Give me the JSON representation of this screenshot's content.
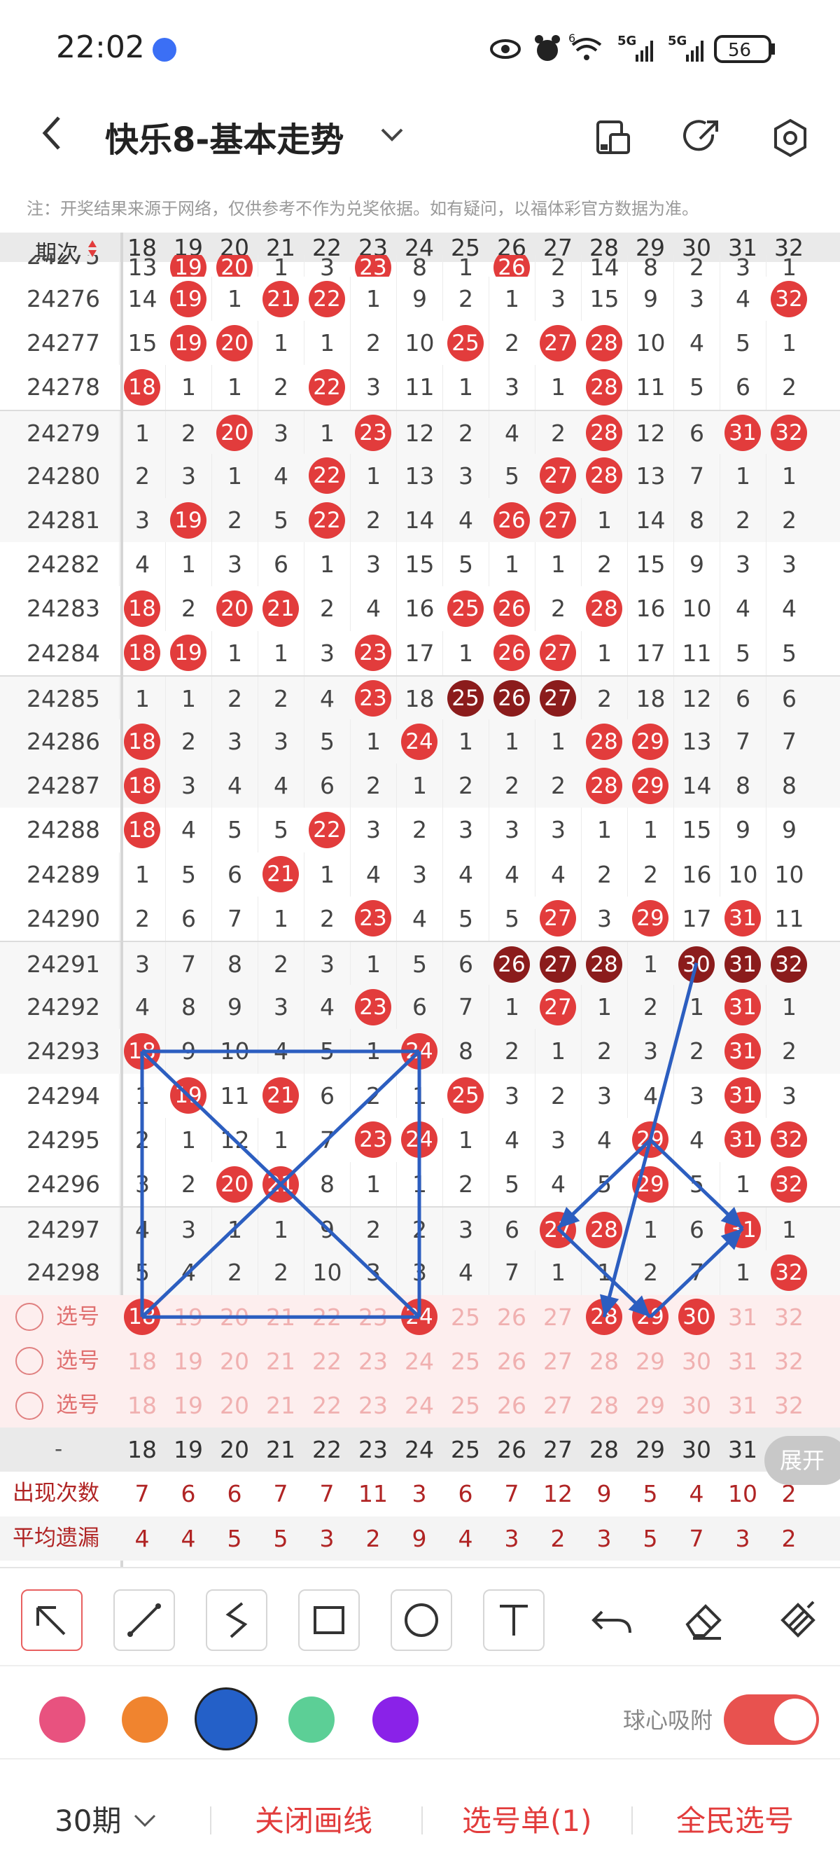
{
  "status_bar": {
    "time": "22:02",
    "battery": "56",
    "net1": "5G",
    "net2": "5G",
    "wifi_badge": "6"
  },
  "header": {
    "title": "快乐8-基本走势",
    "icons": [
      "back-arrow-icon",
      "dropdown-chevron-icon",
      "layout-icon",
      "share-icon",
      "settings-icon"
    ]
  },
  "note": "注：开奖结果来源于网络，仅供参考不作为兑奖依据。如有疑问，以福体彩官方数据为准。",
  "table": {
    "header_label": "期次",
    "sort_icon": "sort-icon",
    "columns": [
      "18",
      "19",
      "20",
      "21",
      "22",
      "23",
      "24",
      "25",
      "26",
      "27",
      "28",
      "29",
      "30",
      "31",
      "32"
    ],
    "partial_row_period": "24275",
    "partial_row_cells": [
      "13",
      "19",
      "20",
      "1",
      "3",
      "23",
      "8",
      "1",
      "26",
      "2",
      "14",
      "8",
      "2",
      "3",
      "1"
    ],
    "rows": [
      {
        "period": "24276",
        "cells": [
          "14",
          "19",
          "1",
          "21",
          "22",
          "1",
          "9",
          "2",
          "1",
          "3",
          "15",
          "9",
          "3",
          "4",
          "32"
        ]
      },
      {
        "period": "24277",
        "cells": [
          "15",
          "19",
          "20",
          "1",
          "1",
          "2",
          "10",
          "25",
          "2",
          "27",
          "28",
          "10",
          "4",
          "5",
          "1"
        ]
      },
      {
        "period": "24278",
        "cells": [
          "18",
          "1",
          "1",
          "2",
          "22",
          "3",
          "11",
          "1",
          "3",
          "1",
          "28",
          "11",
          "5",
          "6",
          "2"
        ]
      },
      {
        "period": "24279",
        "cells": [
          "1",
          "2",
          "20",
          "3",
          "1",
          "23",
          "12",
          "2",
          "4",
          "2",
          "28",
          "12",
          "6",
          "31",
          "32"
        ]
      },
      {
        "period": "24280",
        "cells": [
          "2",
          "3",
          "1",
          "4",
          "22",
          "1",
          "13",
          "3",
          "5",
          "27",
          "28",
          "13",
          "7",
          "1",
          "1"
        ]
      },
      {
        "period": "24281",
        "cells": [
          "3",
          "19",
          "2",
          "5",
          "22",
          "2",
          "14",
          "4",
          "26",
          "27",
          "1",
          "14",
          "8",
          "2",
          "2"
        ]
      },
      {
        "period": "24282",
        "cells": [
          "4",
          "1",
          "3",
          "6",
          "1",
          "3",
          "15",
          "5",
          "1",
          "1",
          "2",
          "15",
          "9",
          "3",
          "3"
        ]
      },
      {
        "period": "24283",
        "cells": [
          "18",
          "2",
          "20",
          "21",
          "2",
          "4",
          "16",
          "25",
          "26",
          "2",
          "28",
          "16",
          "10",
          "4",
          "4"
        ]
      },
      {
        "period": "24284",
        "cells": [
          "18",
          "19",
          "1",
          "1",
          "3",
          "23",
          "17",
          "1",
          "26",
          "27",
          "1",
          "17",
          "11",
          "5",
          "5"
        ]
      },
      {
        "period": "24285",
        "cells": [
          "1",
          "1",
          "2",
          "2",
          "4",
          "23",
          "18",
          "25",
          "26",
          "27",
          "2",
          "18",
          "12",
          "6",
          "6"
        ]
      },
      {
        "period": "24286",
        "cells": [
          "18",
          "2",
          "3",
          "3",
          "5",
          "1",
          "24",
          "1",
          "1",
          "1",
          "28",
          "29",
          "13",
          "7",
          "7"
        ]
      },
      {
        "period": "24287",
        "cells": [
          "18",
          "3",
          "4",
          "4",
          "6",
          "2",
          "1",
          "2",
          "2",
          "2",
          "28",
          "29",
          "14",
          "8",
          "8"
        ]
      },
      {
        "period": "24288",
        "cells": [
          "18",
          "4",
          "5",
          "5",
          "22",
          "3",
          "2",
          "3",
          "3",
          "3",
          "1",
          "1",
          "15",
          "9",
          "9"
        ]
      },
      {
        "period": "24289",
        "cells": [
          "1",
          "5",
          "6",
          "21",
          "1",
          "4",
          "3",
          "4",
          "4",
          "4",
          "2",
          "2",
          "16",
          "10",
          "10"
        ]
      },
      {
        "period": "24290",
        "cells": [
          "2",
          "6",
          "7",
          "1",
          "2",
          "23",
          "4",
          "5",
          "5",
          "27",
          "3",
          "29",
          "17",
          "31",
          "11"
        ]
      },
      {
        "period": "24291",
        "cells": [
          "3",
          "7",
          "8",
          "2",
          "3",
          "1",
          "5",
          "6",
          "26",
          "27",
          "28",
          "1",
          "30",
          "31",
          "32"
        ]
      },
      {
        "period": "24292",
        "cells": [
          "4",
          "8",
          "9",
          "3",
          "4",
          "23",
          "6",
          "7",
          "1",
          "27",
          "1",
          "2",
          "1",
          "31",
          "1"
        ]
      },
      {
        "period": "24293",
        "cells": [
          "18",
          "9",
          "10",
          "4",
          "5",
          "1",
          "24",
          "8",
          "2",
          "1",
          "2",
          "3",
          "2",
          "31",
          "2"
        ]
      },
      {
        "period": "24294",
        "cells": [
          "1",
          "19",
          "11",
          "21",
          "6",
          "2",
          "1",
          "25",
          "3",
          "2",
          "3",
          "4",
          "3",
          "31",
          "3"
        ]
      },
      {
        "period": "24295",
        "cells": [
          "2",
          "1",
          "12",
          "1",
          "7",
          "23",
          "24",
          "1",
          "4",
          "3",
          "4",
          "29",
          "4",
          "31",
          "32"
        ]
      },
      {
        "period": "24296",
        "cells": [
          "3",
          "2",
          "20",
          "21",
          "8",
          "1",
          "1",
          "2",
          "5",
          "4",
          "5",
          "29",
          "5",
          "1",
          "32"
        ]
      },
      {
        "period": "24297",
        "cells": [
          "4",
          "3",
          "1",
          "1",
          "9",
          "2",
          "2",
          "3",
          "6",
          "27",
          "28",
          "1",
          "6",
          "31",
          "1"
        ]
      },
      {
        "period": "24298",
        "cells": [
          "5",
          "4",
          "2",
          "2",
          "10",
          "3",
          "3",
          "4",
          "7",
          "1",
          "1",
          "2",
          "7",
          "1",
          "32"
        ]
      }
    ],
    "balls": {
      "24275": [
        19,
        20,
        23,
        26
      ],
      "24276": [
        19,
        21,
        22,
        32
      ],
      "24277": [
        19,
        20,
        25,
        27,
        28
      ],
      "24278": [
        18,
        22,
        28
      ],
      "24279": [
        20,
        23,
        28,
        31,
        32
      ],
      "24280": [
        22,
        27,
        28
      ],
      "24281": [
        19,
        22,
        26,
        27
      ],
      "24282": [],
      "24283": [
        18,
        20,
        21,
        25,
        26,
        28
      ],
      "24284": [
        18,
        19,
        23,
        26,
        27
      ],
      "24285": [
        23
      ],
      "24286": [
        18,
        24,
        28,
        29
      ],
      "24287": [
        18,
        28,
        29
      ],
      "24288": [
        18,
        22
      ],
      "24289": [
        21
      ],
      "24290": [
        23,
        27,
        29,
        31
      ],
      "24291": [],
      "24292": [
        23,
        27,
        31
      ],
      "24293": [
        18,
        24,
        31
      ],
      "24294": [
        19,
        21,
        25,
        31
      ],
      "24295": [
        23,
        24,
        29,
        31,
        32
      ],
      "24296": [
        20,
        21,
        29,
        32
      ],
      "24297": [
        27,
        28,
        31
      ],
      "24298": [
        32
      ]
    },
    "dark_balls": {
      "24285": [
        25,
        26,
        27
      ],
      "24291": [
        26,
        27,
        28,
        30,
        31,
        32
      ]
    },
    "select_rows": [
      {
        "label": "选号",
        "selected": [
          18,
          24,
          28,
          29,
          30
        ]
      },
      {
        "label": "选号",
        "selected": []
      },
      {
        "label": "选号",
        "selected": []
      }
    ],
    "dash_row_label": "-",
    "stats": [
      {
        "label": "出现次数",
        "values": [
          "7",
          "6",
          "6",
          "7",
          "7",
          "11",
          "3",
          "6",
          "7",
          "12",
          "9",
          "5",
          "4",
          "10",
          "2"
        ]
      },
      {
        "label": "平均遗漏",
        "values": [
          "4",
          "4",
          "5",
          "5",
          "3",
          "2",
          "9",
          "4",
          "3",
          "2",
          "3",
          "5",
          "7",
          "3",
          "2"
        ]
      }
    ],
    "expand_label": "展开"
  },
  "toolbar": {
    "tools": [
      "arrow-tool-icon",
      "line-tool-icon",
      "curve-tool-icon",
      "rect-tool-icon",
      "circle-tool-icon",
      "text-tool-icon",
      "undo-icon",
      "eraser-icon",
      "clear-icon"
    ]
  },
  "colors": {
    "swatches": [
      "#e8527f",
      "#f0842f",
      "#2460c8",
      "#5ccf96",
      "#8a22e8"
    ],
    "selected_index": 2,
    "snap_label": "球心吸附",
    "snap_on": true,
    "accent": "#e23c3c",
    "line_color": "#2c5ec0"
  },
  "bottom_bar": {
    "period": "30期",
    "close_lines": "关闭画线",
    "selection_list": "选号单(1)",
    "all_pick": "全民选号"
  }
}
